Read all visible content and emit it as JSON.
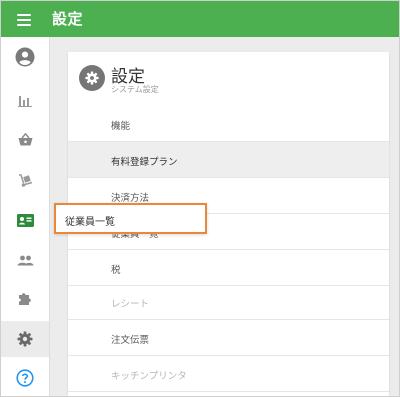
{
  "topbar": {
    "title": "設定"
  },
  "sidebar": {
    "items": [
      {
        "icon": "account-icon"
      },
      {
        "icon": "bar-chart-icon"
      },
      {
        "icon": "basket-icon"
      },
      {
        "icon": "truck-icon"
      },
      {
        "icon": "employee-card-icon"
      },
      {
        "icon": "people-icon"
      },
      {
        "icon": "puzzle-icon"
      },
      {
        "icon": "gear-icon",
        "active": true
      },
      {
        "icon": "help-icon"
      }
    ],
    "tooltip": "従業員一覧"
  },
  "card": {
    "title": "設定",
    "subtitle": "システム設定",
    "menu": [
      {
        "label": "機能"
      },
      {
        "label": "有料登録プラン",
        "highlight": true
      },
      {
        "label": "決済方法"
      },
      {
        "label": "従業員一覧"
      },
      {
        "label": "税"
      },
      {
        "label": "レシート",
        "disabled": true
      },
      {
        "label": "注文伝票"
      },
      {
        "label": "キッチンプリンタ",
        "disabled": true
      }
    ]
  },
  "colors": {
    "topbar": "#4caf50",
    "icon_gray": "#8a8a8a",
    "icon_green": "#3a9a3e",
    "help_blue": "#2196f3",
    "tooltip_border": "#e8883a"
  }
}
